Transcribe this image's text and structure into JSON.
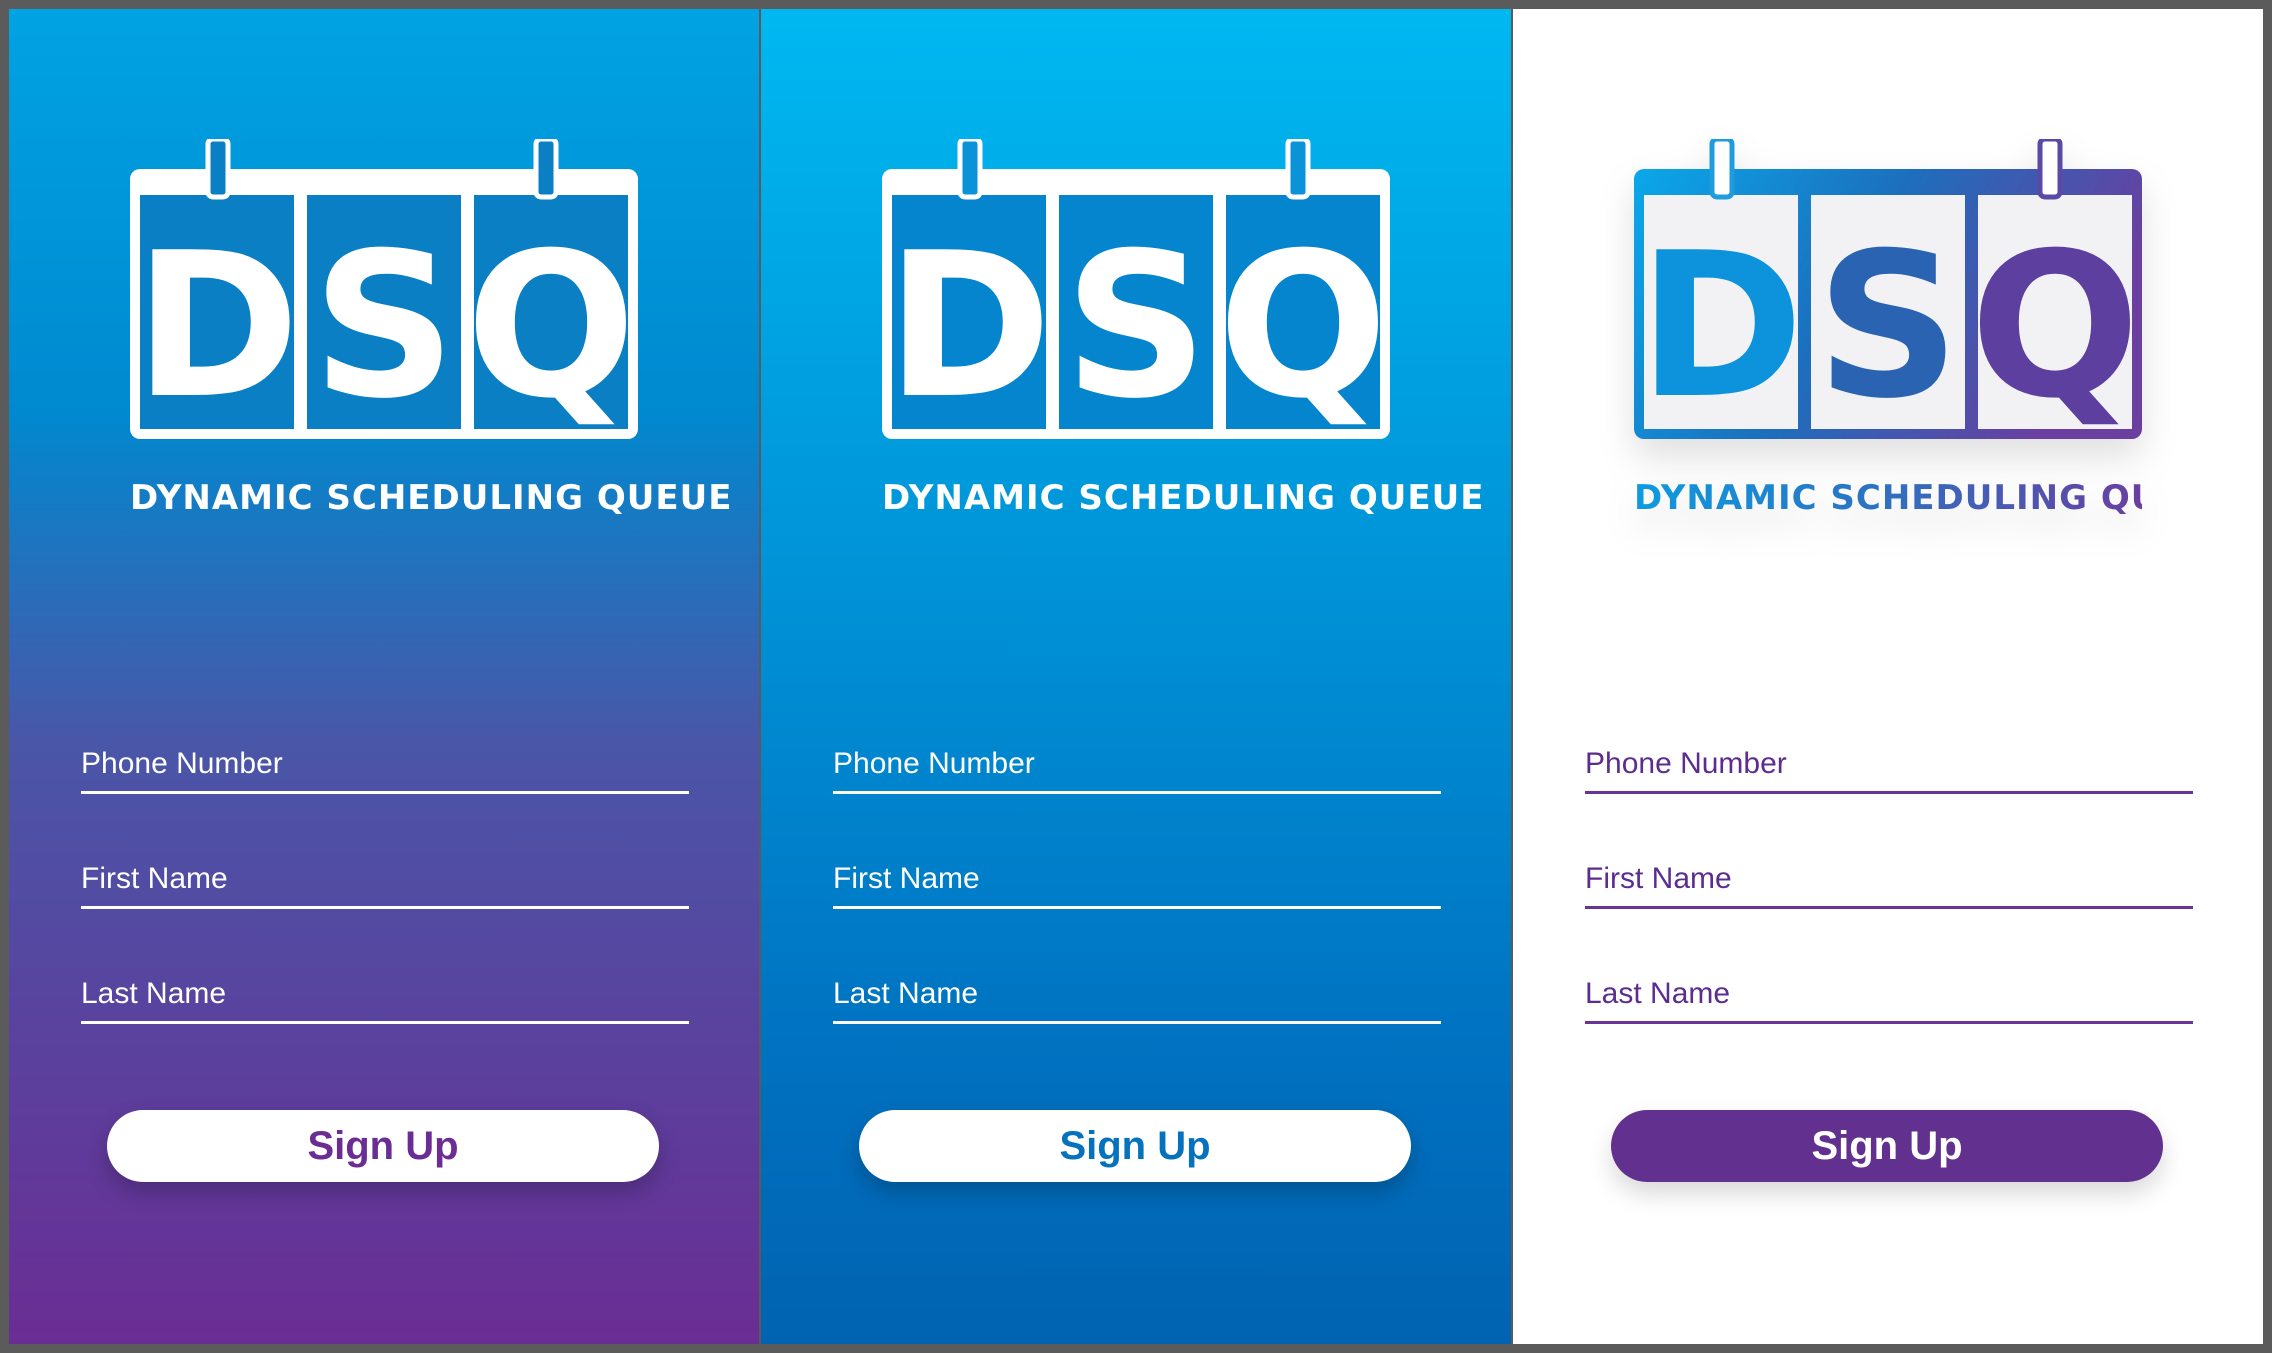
{
  "logo": {
    "letters": [
      "D",
      "S",
      "Q"
    ],
    "tagline": "DYNAMIC SCHEDULING QUEUE"
  },
  "variants": [
    {
      "theme": "purple-gradient",
      "colors": {
        "top": "#00a3e3",
        "bottom": "#6a2d94",
        "button_text": "#6a2d94"
      },
      "fields": {
        "phone_placeholder": "Phone Number",
        "first_placeholder": "First Name",
        "last_placeholder": "Last Name"
      },
      "button_label": "Sign Up"
    },
    {
      "theme": "blue-gradient",
      "colors": {
        "top": "#00b8f1",
        "bottom": "#0063b1",
        "button_text": "#0672bd"
      },
      "fields": {
        "phone_placeholder": "Phone Number",
        "first_placeholder": "First Name",
        "last_placeholder": "Last Name"
      },
      "button_label": "Sign Up"
    },
    {
      "theme": "white",
      "colors": {
        "background": "#ffffff",
        "accent": "#62318f",
        "logo_gradient_start": "#0d9be0",
        "logo_gradient_end": "#6a3fa0"
      },
      "fields": {
        "phone_placeholder": "Phone Number",
        "first_placeholder": "First Name",
        "last_placeholder": "Last Name"
      },
      "button_label": "Sign Up"
    }
  ]
}
